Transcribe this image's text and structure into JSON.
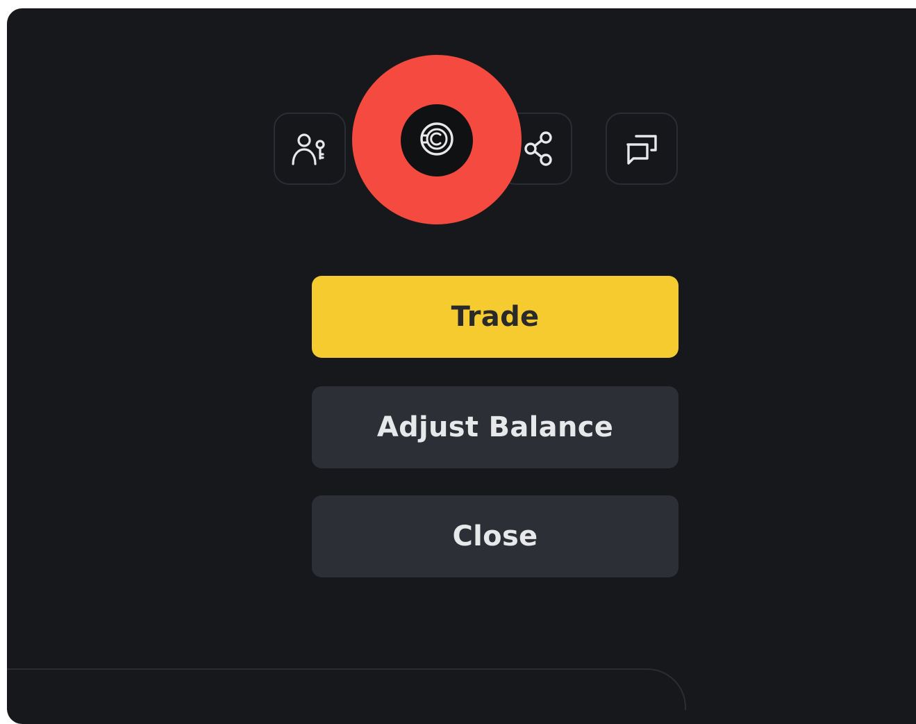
{
  "toolbar": {
    "icons": [
      {
        "name": "copy-trading-icon"
      },
      {
        "name": "coin-icon",
        "highlighted": true
      },
      {
        "name": "share-icon"
      },
      {
        "name": "chat-windows-icon"
      }
    ]
  },
  "actions": {
    "trade_label": "Trade",
    "adjust_balance_label": "Adjust Balance",
    "close_label": "Close"
  },
  "colors": {
    "background": "#17181b",
    "primary_button": "#f6cb2f",
    "secondary_button": "#2c2f36",
    "highlight": "#f44a3f"
  }
}
